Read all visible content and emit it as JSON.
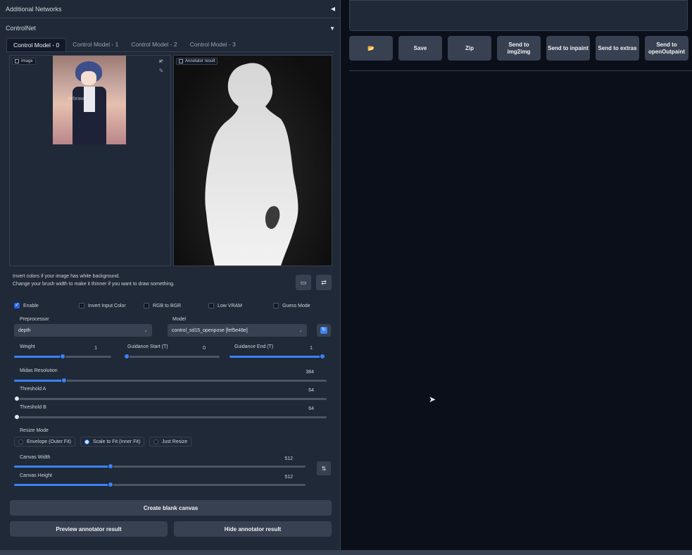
{
  "accordions": {
    "additional_networks": "Additional Networks",
    "controlnet": "ControlNet"
  },
  "tabs": [
    "Control Model - 0",
    "Control Model - 1",
    "Control Model - 2",
    "Control Model - 3"
  ],
  "image_panel": {
    "label": "Image",
    "watermark": "rrrbrawl"
  },
  "annotator_panel": {
    "label": "Annotator result"
  },
  "hints": {
    "line1": "Invert colors if your image has white background.",
    "line2": "Change your brush width to make it thinner if you want to draw something."
  },
  "checkboxes": {
    "enable": {
      "label": "Enable",
      "checked": true
    },
    "invert": {
      "label": "Invert Input Color",
      "checked": false
    },
    "rgb_bgr": {
      "label": "RGB to BGR",
      "checked": false
    },
    "low_vram": {
      "label": "Low VRAM",
      "checked": false
    },
    "guess": {
      "label": "Guess Mode",
      "checked": false
    }
  },
  "preprocessor": {
    "label": "Preprocessor",
    "value": "depth"
  },
  "model": {
    "label": "Model",
    "value": "control_sd15_openpose [fef5e48e]"
  },
  "sliders": {
    "weight": {
      "label": "Weight",
      "value": "1",
      "fraction": 0.5
    },
    "guidance_start": {
      "label": "Guidance Start (T)",
      "value": "0",
      "fraction": 0.0
    },
    "guidance_end": {
      "label": "Guidance End (T)",
      "value": "1",
      "fraction": 1.0
    },
    "midas": {
      "label": "Midas Resolution",
      "value": "384",
      "fraction": 0.16
    },
    "threshold_a": {
      "label": "Threshold A",
      "value": "64",
      "fraction": 0.0
    },
    "threshold_b": {
      "label": "Threshold B",
      "value": "64",
      "fraction": 0.0
    },
    "canvas_width": {
      "label": "Canvas Width",
      "value": "512",
      "fraction": 0.33
    },
    "canvas_height": {
      "label": "Canvas Height",
      "value": "512",
      "fraction": 0.33
    }
  },
  "resize_mode": {
    "label": "Resize Mode",
    "options": [
      "Envelope (Outer Fit)",
      "Scale to Fit (Inner Fit)",
      "Just Resize"
    ],
    "selected": "Scale to Fit (Inner Fit)"
  },
  "buttons": {
    "create_canvas": "Create blank canvas",
    "preview": "Preview annotator result",
    "hide": "Hide annotator result",
    "swap": "⇅",
    "swap2": "⇄"
  },
  "right_buttons": {
    "folder": "📂",
    "save": "Save",
    "zip": "Zip",
    "img2img": "Send to img2img",
    "inpaint": "Send to inpaint",
    "extras": "Send to extras",
    "openoutpaint": "Send to openOutpaint"
  },
  "colors": {
    "accent": "#3b82f6",
    "panel": "#1f2937",
    "background": "#0b0f19"
  }
}
